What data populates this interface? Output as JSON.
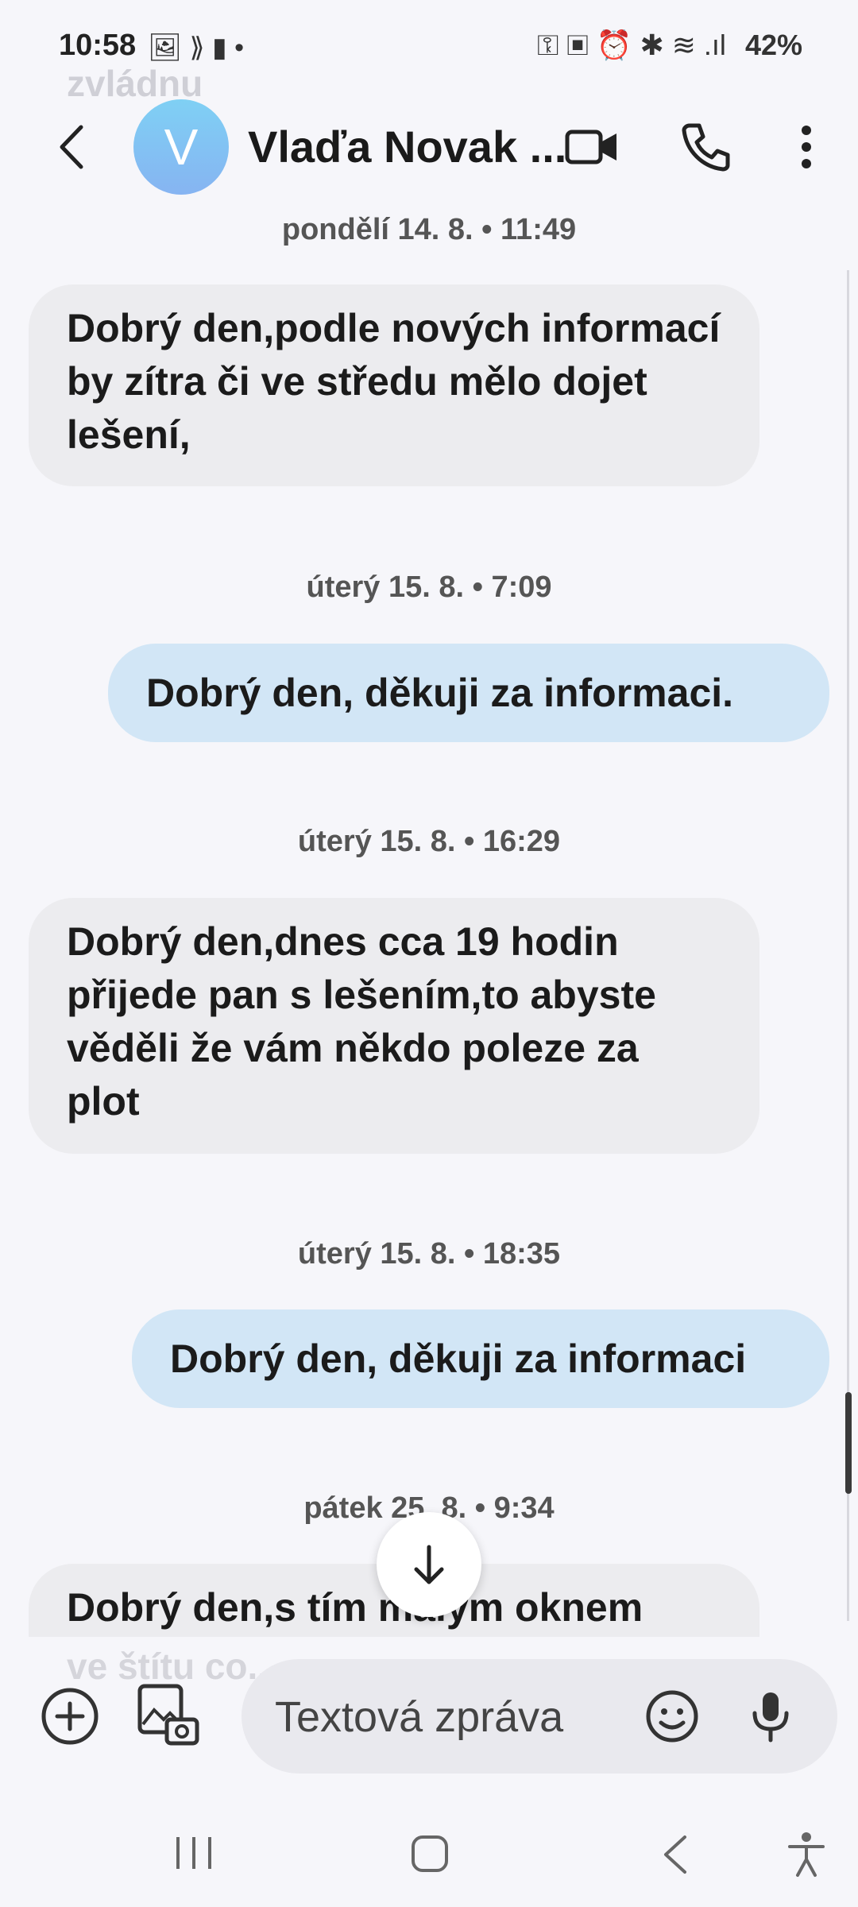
{
  "status_bar": {
    "time": "10:58",
    "left_icons": "🖼 ⟫ ▮ •",
    "right_icons": "⚿ ▣ ⏰ ✱ ≋ .ıl",
    "battery": "42%"
  },
  "scrolled_text_top": "zvládnu",
  "header": {
    "avatar_letter": "V",
    "contact_name": "Vlaďa Novak ...",
    "avatar_colors": [
      "#7fd0f4",
      "#86b4f2"
    ]
  },
  "conversation": [
    {
      "type": "timestamp",
      "text": "pondělí 14. 8. • 11:49"
    },
    {
      "type": "incoming",
      "text": "Dobrý den,podle nových informací by zítra či ve středu mělo dojet lešení,"
    },
    {
      "type": "timestamp",
      "text": "úterý 15. 8. • 7:09"
    },
    {
      "type": "outgoing",
      "text": "Dobrý den, děkuji za  informaci."
    },
    {
      "type": "timestamp",
      "text": "úterý 15. 8. • 16:29"
    },
    {
      "type": "incoming",
      "text": "Dobrý den,dnes cca 19 hodin přijede pan s lešením,to abyste věděli že vám někdo poleze za plot"
    },
    {
      "type": "timestamp",
      "text": "úterý 15. 8. • 18:35"
    },
    {
      "type": "outgoing",
      "text": "Dobrý den,  děkuji za informaci"
    },
    {
      "type": "timestamp",
      "text": "pátek 25. 8. • 9:34"
    },
    {
      "type": "incoming",
      "text": "Dobrý den,s tím malým oknem"
    }
  ],
  "scrolled_text_bottom": "ve štítu co...",
  "composer": {
    "placeholder": "Textová zpráva"
  },
  "colors": {
    "background": "#f6f6fa",
    "incoming_bubble": "#ececef",
    "outgoing_bubble": "#d2e6f6"
  },
  "icons": [
    "back-icon",
    "video-call-icon",
    "phone-icon",
    "more-vertical-icon",
    "arrow-down-icon",
    "add-icon",
    "gallery-camera-icon",
    "emoji-icon",
    "microphone-icon",
    "recent-apps-icon",
    "home-icon",
    "nav-back-icon",
    "accessibility-icon"
  ]
}
